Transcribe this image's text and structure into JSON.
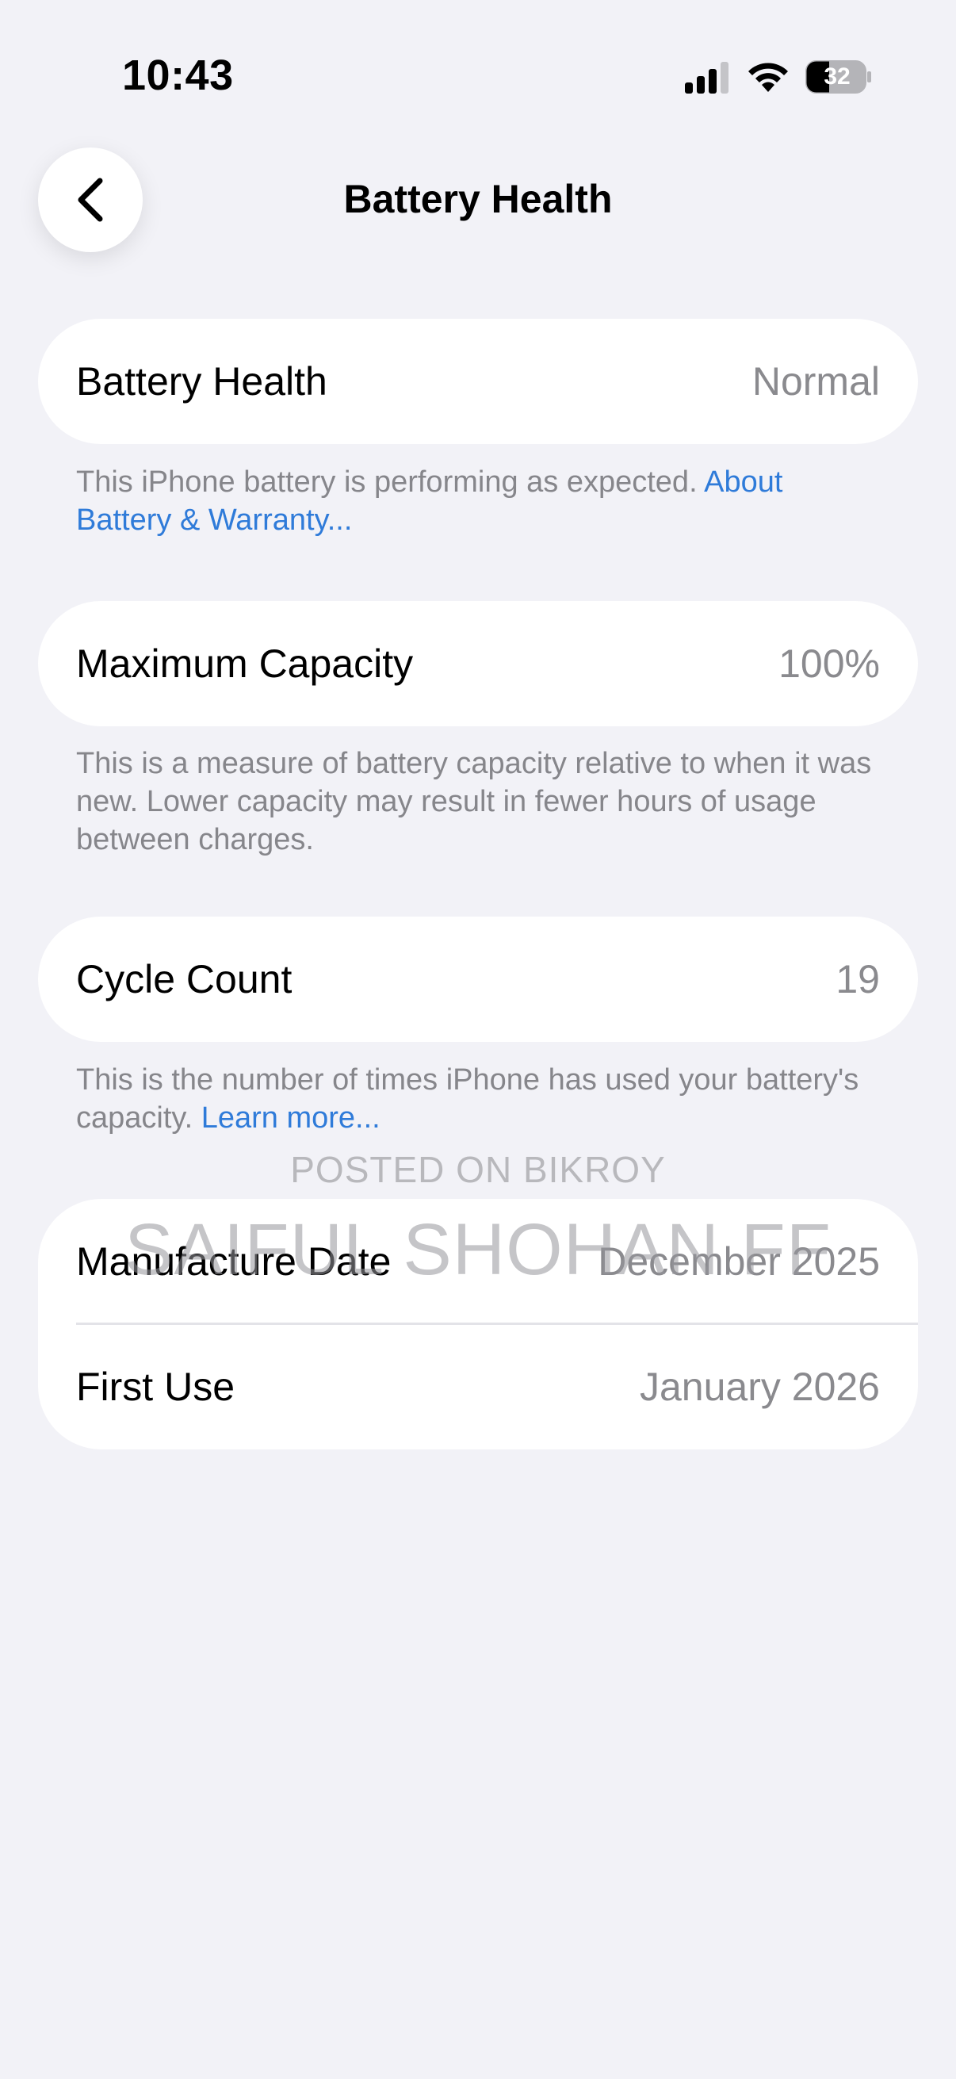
{
  "status_bar": {
    "time": "10:43",
    "battery_level": "32",
    "icons": [
      "signal-icon",
      "wifi-icon",
      "battery-icon"
    ]
  },
  "nav": {
    "title": "Battery Health",
    "back_icon": "chevron-left-icon"
  },
  "battery_health": {
    "label": "Battery Health",
    "value": "Normal",
    "note": "This iPhone battery is performing as expected. ",
    "note_link": "About Battery & Warranty..."
  },
  "max_capacity": {
    "label": "Maximum Capacity",
    "value": "100%",
    "note": "This is a measure of battery capacity relative to when it was new. Lower capacity may result in fewer hours of usage between charges."
  },
  "cycle_count": {
    "label": "Cycle Count",
    "value": "19",
    "note": "This is the number of times iPhone has used your battery's capacity. ",
    "note_link": "Learn more..."
  },
  "dates": {
    "manufacture_label": "Manufacture Date",
    "manufacture_value": "December 2025",
    "first_use_label": "First Use",
    "first_use_value": "January 2026"
  },
  "watermark": {
    "line1": "POSTED ON BIKROY",
    "line2": "SAIFUL SHOHAN FF"
  },
  "colors": {
    "background": "#f2f2f7",
    "card": "#ffffff",
    "link": "#2f7bd9",
    "secondary_text": "#8a8a8e"
  }
}
